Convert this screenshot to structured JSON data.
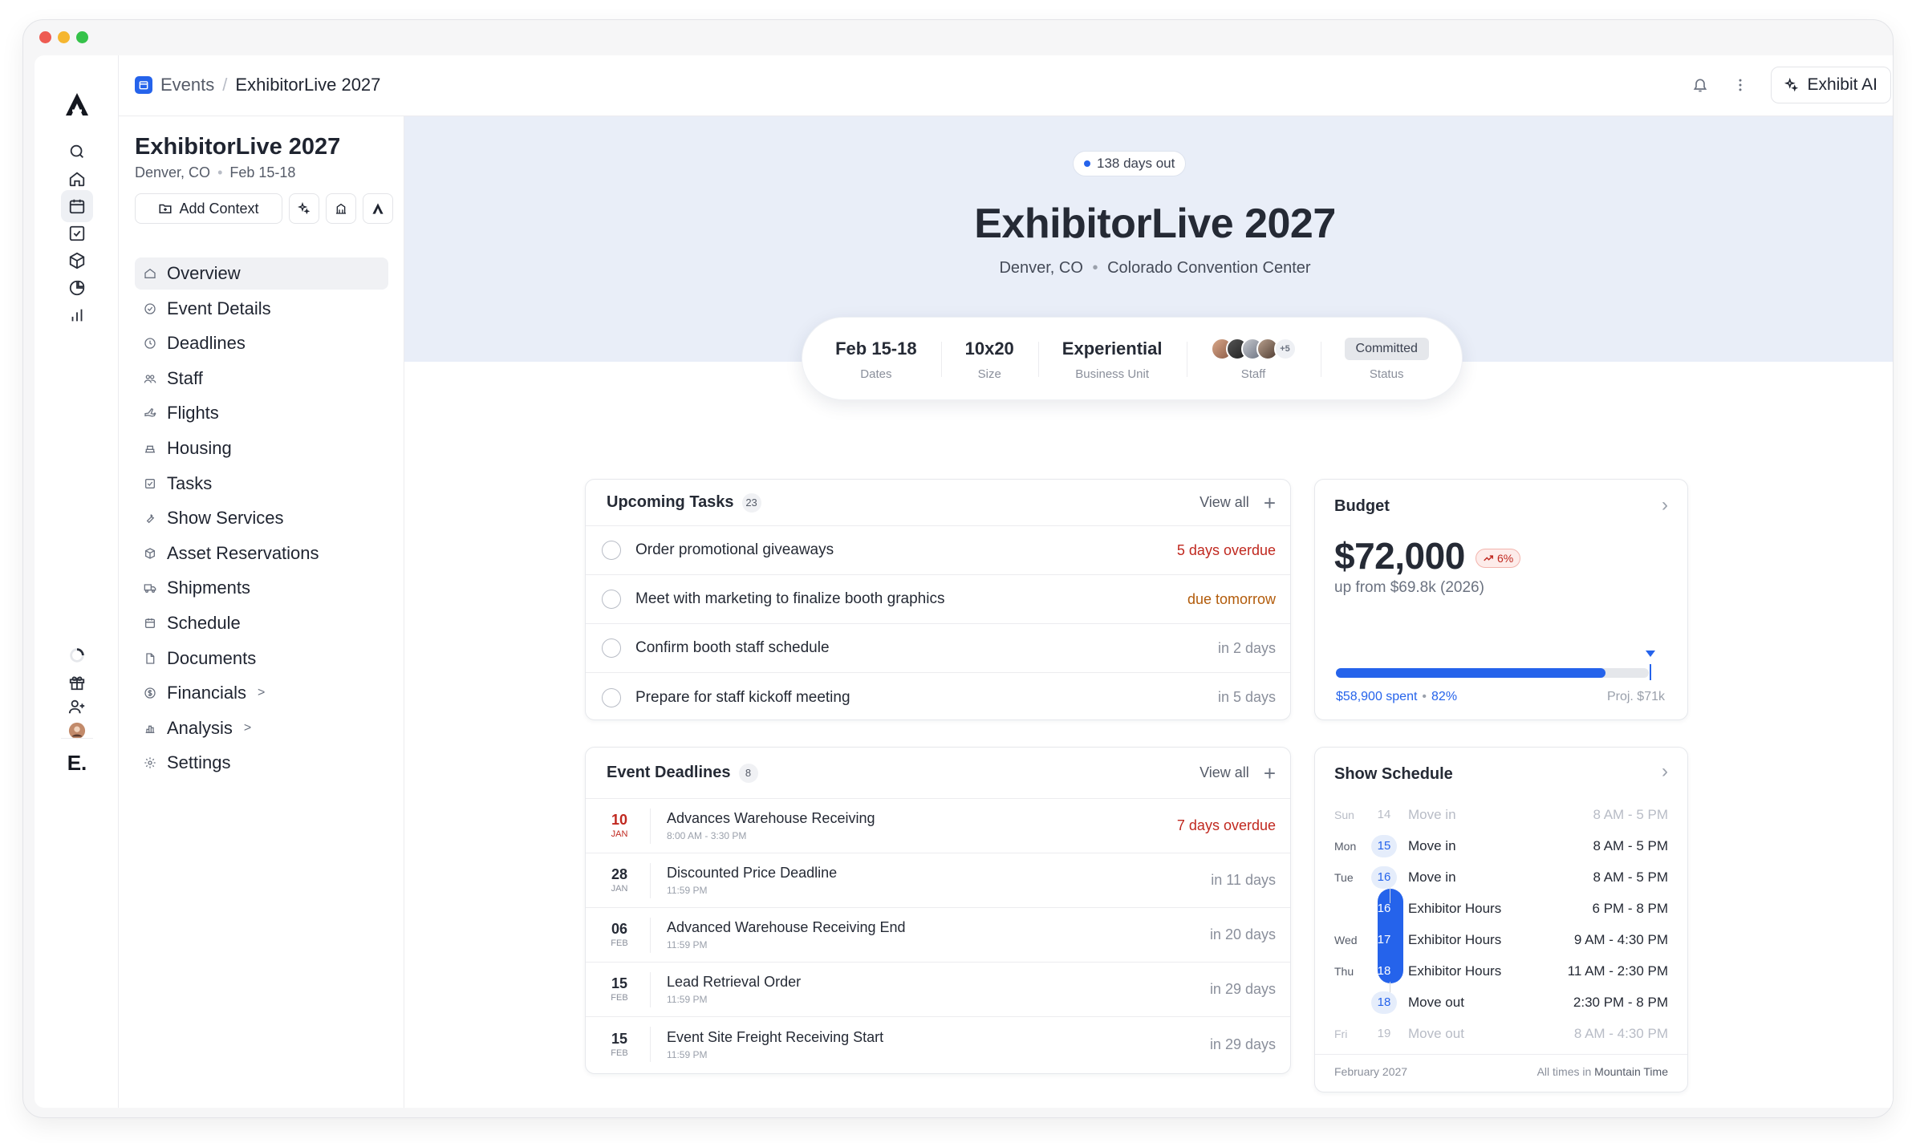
{
  "window": {
    "traffic_colors": [
      "#ee5b52",
      "#f5b630",
      "#35c24a"
    ]
  },
  "rail": {
    "icons": [
      "search-icon",
      "home-icon",
      "calendar-icon",
      "checkbox-icon",
      "box-icon",
      "pie-chart-icon",
      "bar-chart-icon"
    ],
    "bottom_icons": [
      "loading-icon",
      "gift-icon",
      "user-plus-icon",
      "avatar",
      "brand-logo"
    ],
    "brand_mark": "E."
  },
  "topbar": {
    "breadcrumb_root": "Events",
    "breadcrumb_separator": "/",
    "breadcrumb_current": "ExhibitorLive 2027",
    "ai_button": "Exhibit AI"
  },
  "sidebar": {
    "title": "ExhibitorLive 2027",
    "location": "Denver, CO",
    "dates": "Feb 15-18",
    "add_context": "Add Context",
    "items": [
      {
        "label": "Overview",
        "icon": "home-icon",
        "active": true
      },
      {
        "label": "Event Details",
        "icon": "check-circle-icon"
      },
      {
        "label": "Deadlines",
        "icon": "clock-icon"
      },
      {
        "label": "Staff",
        "icon": "users-icon"
      },
      {
        "label": "Flights",
        "icon": "plane-icon"
      },
      {
        "label": "Housing",
        "icon": "bed-icon"
      },
      {
        "label": "Tasks",
        "icon": "checkbox-icon"
      },
      {
        "label": "Show Services",
        "icon": "wrench-icon"
      },
      {
        "label": "Asset Reservations",
        "icon": "box-icon"
      },
      {
        "label": "Shipments",
        "icon": "truck-icon"
      },
      {
        "label": "Schedule",
        "icon": "calendar-icon"
      },
      {
        "label": "Documents",
        "icon": "file-icon"
      },
      {
        "label": "Financials",
        "icon": "dollar-icon",
        "chevron": ">"
      },
      {
        "label": "Analysis",
        "icon": "chart-icon",
        "chevron": ">"
      },
      {
        "label": "Settings",
        "icon": "gear-icon"
      }
    ]
  },
  "hero": {
    "countdown": "138 days out",
    "title": "ExhibitorLive 2027",
    "location": "Denver, CO",
    "venue": "Colorado Convention Center",
    "bg_color": "#e9eef8"
  },
  "stats": {
    "dates_value": "Feb 15-18",
    "dates_label": "Dates",
    "size_value": "10x20",
    "size_label": "Size",
    "unit_value": "Experiential",
    "unit_label": "Business Unit",
    "staff_more": "+5",
    "staff_label": "Staff",
    "status_value": "Committed",
    "status_label": "Status"
  },
  "tasks": {
    "title": "Upcoming Tasks",
    "count": "23",
    "view_all": "View all",
    "rows": [
      {
        "text": "Order promotional giveaways",
        "due": "5 days overdue",
        "tone": "red"
      },
      {
        "text": "Meet with marketing to finalize booth graphics",
        "due": "due tomorrow",
        "tone": "amber"
      },
      {
        "text": "Confirm booth staff schedule",
        "due": "in 2 days",
        "tone": "gray"
      },
      {
        "text": "Prepare for staff kickoff meeting",
        "due": "in 5 days",
        "tone": "gray"
      }
    ]
  },
  "deadlines": {
    "title": "Event Deadlines",
    "count": "8",
    "view_all": "View all",
    "rows": [
      {
        "day": "10",
        "month": "JAN",
        "name": "Advances Warehouse Receiving",
        "sub": "8:00 AM - 3:30 PM",
        "due": "7 days overdue",
        "tone": "red"
      },
      {
        "day": "28",
        "month": "JAN",
        "name": "Discounted Price Deadline",
        "sub": "11:59 PM",
        "due": "in 11 days",
        "tone": "gray"
      },
      {
        "day": "06",
        "month": "FEB",
        "name": "Advanced Warehouse Receiving End",
        "sub": "11:59 PM",
        "due": "in 20 days",
        "tone": "gray"
      },
      {
        "day": "15",
        "month": "FEB",
        "name": "Lead Retrieval Order",
        "sub": "11:59 PM",
        "due": "in 29 days",
        "tone": "gray"
      },
      {
        "day": "15",
        "month": "FEB",
        "name": "Event Site Freight Receiving Start",
        "sub": "11:59 PM",
        "due": "in 29 days",
        "tone": "gray"
      }
    ]
  },
  "budget": {
    "title": "Budget",
    "amount": "$72,000",
    "trend": "6%",
    "up_from": "up from $69.8k (2026)",
    "spent": "$58,900 spent",
    "percent": "82%",
    "spent_fraction": 0.82,
    "projected": "Proj. $71k",
    "accent": "#2563eb"
  },
  "schedule": {
    "title": "Show Schedule",
    "rows": [
      {
        "dow": "Sun",
        "day": "14",
        "what": "Move in",
        "time": "8 AM - 5 PM",
        "style": "muted"
      },
      {
        "dow": "Mon",
        "day": "15",
        "what": "Move in",
        "time": "8 AM - 5 PM",
        "style": "light"
      },
      {
        "dow": "Tue",
        "day": "16",
        "what": "Move in",
        "time": "8 AM - 5 PM",
        "style": "light"
      },
      {
        "dow": "",
        "day": "16",
        "what": "Exhibitor Hours",
        "time": "6 PM - 8 PM",
        "style": "solid"
      },
      {
        "dow": "Wed",
        "day": "17",
        "what": "Exhibitor Hours",
        "time": "9 AM - 4:30 PM",
        "style": "solid"
      },
      {
        "dow": "Thu",
        "day": "18",
        "what": "Exhibitor Hours",
        "time": "11 AM - 2:30 PM",
        "style": "solid"
      },
      {
        "dow": "",
        "day": "18",
        "what": "Move out",
        "time": "2:30 PM - 8 PM",
        "style": "light"
      },
      {
        "dow": "Fri",
        "day": "19",
        "what": "Move out",
        "time": "8 AM - 4:30 PM",
        "style": "muted"
      }
    ],
    "month": "February 2027",
    "tz_prefix": "All times in",
    "tz": "Mountain Time"
  }
}
